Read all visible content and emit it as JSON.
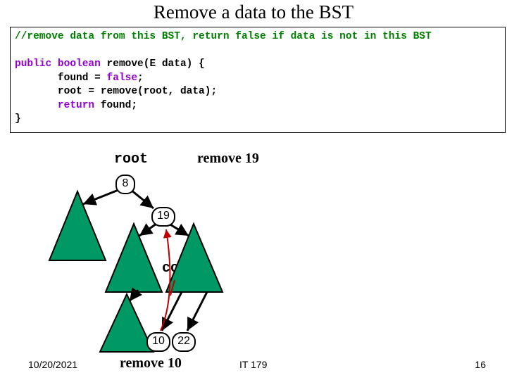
{
  "title": "Remove a data to the BST",
  "code": {
    "comment": "//remove data from this BST, return false if data is not in this BST",
    "l1a": "public",
    "l1b": " boolean",
    "l1c": " remove(E data) {",
    "l2a": "       found = ",
    "l2b": "false",
    "l2c": ";",
    "l3": "       root = remove(root, data);",
    "l4a": "       return",
    "l4b": " found;",
    "l5": "}"
  },
  "labels": {
    "root": "root",
    "remove19": "remove 19",
    "copy": "copy",
    "remove10": "remove 10"
  },
  "nodes": {
    "n8": "8",
    "n19": "19",
    "n10": "10",
    "n22": "22"
  },
  "footer": {
    "date": "10/20/2021",
    "course": "IT 179",
    "slide": "16"
  }
}
